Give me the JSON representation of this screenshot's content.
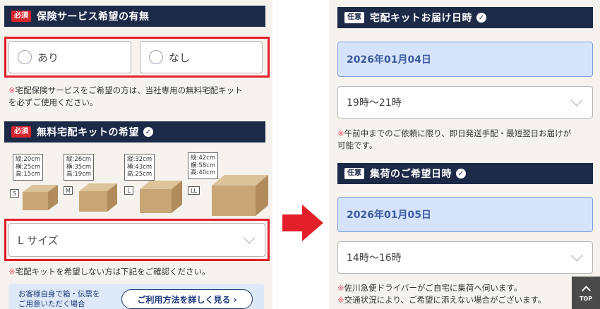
{
  "left": {
    "insurance": {
      "badge": "必須",
      "title": "保険サービス希望の有無",
      "options": [
        "あり",
        "なし"
      ],
      "note_mark": "※",
      "note_line1": "宅配保険サービスをご希望の方は、当社専用の無料宅配キット",
      "note_line2": "を必ずご使用ください。"
    },
    "kit": {
      "badge": "必須",
      "title": "無料宅配キットの希望",
      "boxes": [
        {
          "size": "S",
          "dims": [
            "縦:20cm",
            "横:25cm",
            "高:15cm"
          ]
        },
        {
          "size": "M",
          "dims": [
            "縦:26cm",
            "横:35cm",
            "高:19cm"
          ]
        },
        {
          "size": "L",
          "dims": [
            "縦:32cm",
            "横:43cm",
            "高:25cm"
          ]
        },
        {
          "size": "LL",
          "dims": [
            "縦:42cm",
            "横:58cm",
            "高:40cm"
          ]
        }
      ],
      "selected": "L サイズ",
      "note_mark": "※",
      "note": "宅配キットを希望しない方は下記をご確認ください。"
    },
    "info": {
      "text_line1": "お客様自身で箱・伝票を",
      "text_line2": "ご用意いただく場合",
      "button": "ご利用方法を詳しく見る ›"
    }
  },
  "right": {
    "delivery": {
      "badge": "任意",
      "title": "宅配キットお届け日時",
      "date": "2026年01月04日",
      "time": "19時～21時",
      "note_mark": "※",
      "note_line1": "午前中までのご依頼に限り、即日発送手配・最短翌日お届けが",
      "note_line2": "可能です。"
    },
    "pickup": {
      "badge": "任意",
      "title": "集荷のご希望日時",
      "date": "2026年01月05日",
      "time": "14時～16時",
      "note_mark": "※",
      "note_line1": "佐川急便ドライバーがご自宅に集荷へ伺います。",
      "note_line2": "交通状況により、ご希望に添えない場合がございます。"
    }
  },
  "top_button": "TOP",
  "colors": {
    "header_bg": "#1c2a48",
    "required_badge": "#d6262f",
    "highlight_border": "#e3202a",
    "arrow": "#e3202a",
    "date_bg": "#d6e4fb",
    "panel_bg": "#f6f3ee"
  }
}
